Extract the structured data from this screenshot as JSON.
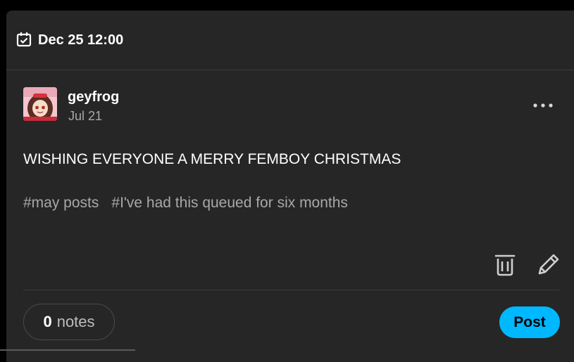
{
  "scheduled": {
    "icon": "calendar-check-icon",
    "datetime": "Dec 25 12:00"
  },
  "post": {
    "author": "geyfrog",
    "date": "Jul 21",
    "avatar_icon": "user-avatar",
    "more_icon": "ellipsis-icon",
    "body": "WISHING EVERYONE A MERRY FEMBOY CHRISTMAS",
    "tags": [
      "#may posts",
      "#I've had this queued for six months"
    ]
  },
  "actions": {
    "delete_icon": "trash-icon",
    "edit_icon": "pencil-icon"
  },
  "footer": {
    "notes_count": "0",
    "notes_label": "notes",
    "post_label": "Post"
  },
  "colors": {
    "background": "#000000",
    "card": "#262626",
    "accent": "#00b8ff",
    "muted_text": "#a8a8a8"
  }
}
